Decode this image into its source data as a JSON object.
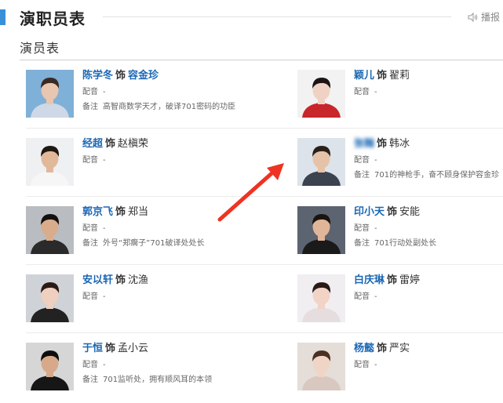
{
  "header": {
    "title": "演职员表",
    "play_label": "播报"
  },
  "section": {
    "subtitle": "演员表"
  },
  "labels": {
    "as": "饰",
    "dub": "配音",
    "note": "备注"
  },
  "cast": [
    {
      "actor": "陈学冬",
      "role": "容金珍",
      "dub": "-",
      "note": "高智商数学天才，破译701密码的功臣",
      "role_link": true,
      "actor_blurred": false,
      "photo": {
        "bg": "#7fb0d8",
        "skin": "#e8c6b0",
        "hair": "#3a2a24",
        "cloth": "#cfd8e6"
      }
    },
    {
      "actor": "颖儿",
      "role": "翟莉",
      "dub": "-",
      "note": "",
      "role_link": false,
      "actor_blurred": false,
      "photo": {
        "bg": "#f2f2f2",
        "skin": "#f0d2c4",
        "hair": "#1c1414",
        "cloth": "#c8262a"
      }
    },
    {
      "actor": "经超",
      "role": "赵槇荣",
      "dub": "-",
      "note": "",
      "role_link": false,
      "actor_blurred": false,
      "photo": {
        "bg": "#eef0f2",
        "skin": "#e2b89a",
        "hair": "#201812",
        "cloth": "#f6f6f6"
      }
    },
    {
      "actor": "张翰",
      "role": "韩冰",
      "dub": "-",
      "note": "701的神枪手，奋不顾身保护容金珍",
      "role_link": false,
      "actor_blurred": true,
      "photo": {
        "bg": "#dde3ea",
        "skin": "#e6c2a8",
        "hair": "#2a201a",
        "cloth": "#3b4250"
      }
    },
    {
      "actor": "郭京飞",
      "role": "郑当",
      "dub": "-",
      "note": "外号“郑瘸子”701破译处处长",
      "role_link": false,
      "actor_blurred": false,
      "photo": {
        "bg": "#b9bcc0",
        "skin": "#d9ac8c",
        "hair": "#141010",
        "cloth": "#2a2a2a"
      }
    },
    {
      "actor": "印小天",
      "role": "安能",
      "dub": "-",
      "note": "701行动处副处长",
      "role_link": false,
      "actor_blurred": false,
      "photo": {
        "bg": "#5b6470",
        "skin": "#e0b598",
        "hair": "#1a1410",
        "cloth": "#1a1a1a"
      }
    },
    {
      "actor": "安以轩",
      "role": "沈渔",
      "dub": "-",
      "note": "",
      "role_link": false,
      "actor_blurred": false,
      "photo": {
        "bg": "#cfd2d6",
        "skin": "#efcfbf",
        "hair": "#2b1a14",
        "cloth": "#222222"
      }
    },
    {
      "actor": "白庆琳",
      "role": "雷婷",
      "dub": "-",
      "note": "",
      "role_link": false,
      "actor_blurred": false,
      "photo": {
        "bg": "#f0eef0",
        "skin": "#f1d4c6",
        "hair": "#2a1a16",
        "cloth": "#e6dede"
      }
    },
    {
      "actor": "于恒",
      "role": "孟小云",
      "dub": "-",
      "note": "701监听处，拥有顺风耳的本领",
      "role_link": false,
      "actor_blurred": false,
      "photo": {
        "bg": "#d6d6d6",
        "skin": "#d7a98a",
        "hair": "#0e0e0e",
        "cloth": "#161616"
      }
    },
    {
      "actor": "杨懿",
      "role": "严实",
      "dub": "-",
      "note": "",
      "role_link": false,
      "actor_blurred": false,
      "photo": {
        "bg": "#e4ddd8",
        "skin": "#f0d4c6",
        "hair": "#4a2f22",
        "cloth": "#d8c8c0"
      }
    }
  ],
  "annotation": {
    "arrow_color": "#ee3322"
  }
}
